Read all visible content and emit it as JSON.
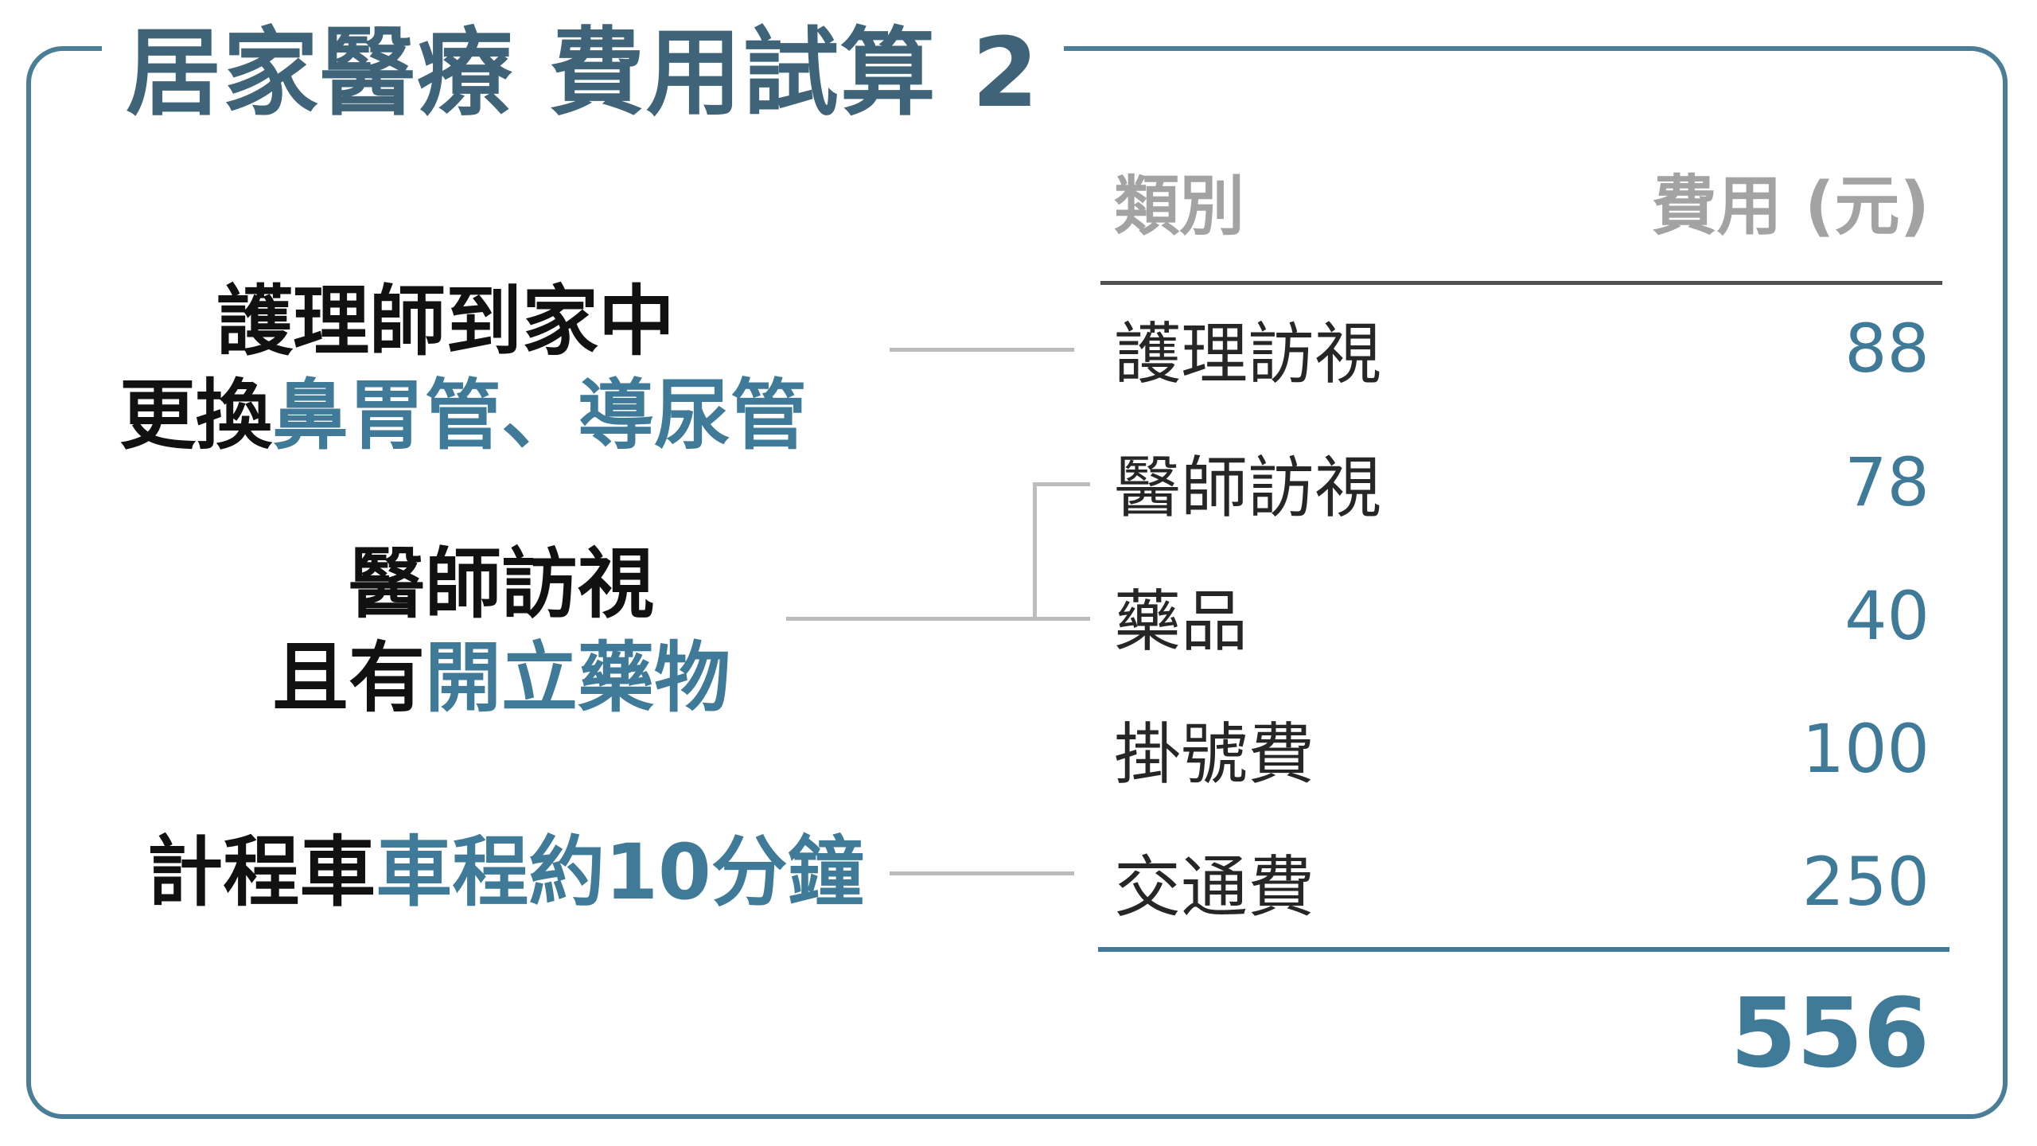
{
  "title": "居家醫療 費用試算 2",
  "table": {
    "header_category": "類別",
    "header_fee": "費用 (元)",
    "rows": [
      {
        "category": "護理訪視",
        "fee": "88"
      },
      {
        "category": "醫師訪視",
        "fee": "78"
      },
      {
        "category": "藥品",
        "fee": "40"
      },
      {
        "category": "掛號費",
        "fee": "100"
      },
      {
        "category": "交通費",
        "fee": "250"
      }
    ],
    "total": "556"
  },
  "labels": {
    "nurse": {
      "line1": "護理師到家中",
      "line2_plain": "更換",
      "line2_highlight": "鼻胃管、導尿管"
    },
    "doctor": {
      "line1": "醫師訪視",
      "line2_plain": "且有",
      "line2_highlight": "開立藥物"
    },
    "taxi": {
      "plain": "計程車",
      "highlight": "車程約10分鐘"
    }
  },
  "colors": {
    "frame": "#4a7d96",
    "title": "#3f6479",
    "accent": "#3f7b98",
    "header_text": "#a3a3a3",
    "connector": "#bcbcbc"
  }
}
